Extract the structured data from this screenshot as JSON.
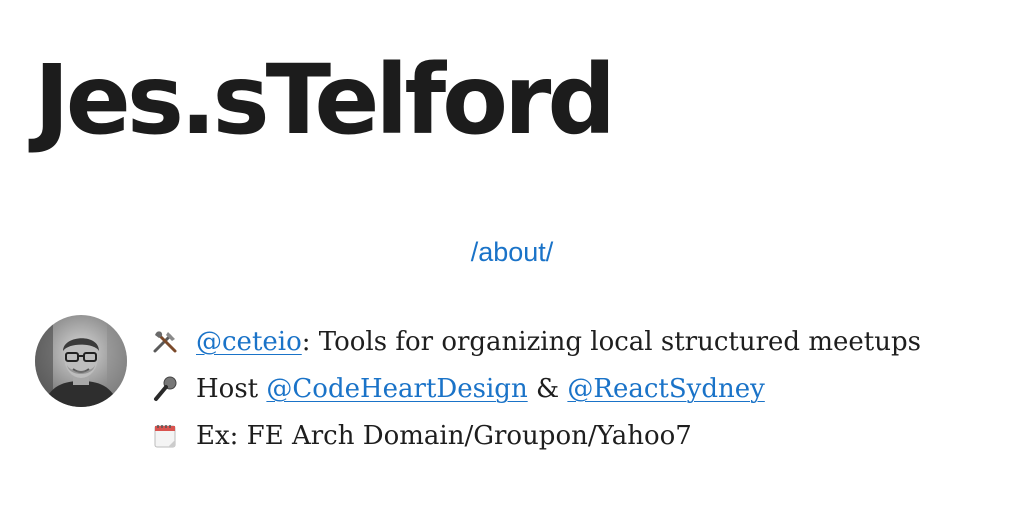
{
  "header": {
    "site_title": "Jes.sTelford"
  },
  "nav": {
    "about_label": "/about/"
  },
  "bio": {
    "line1": {
      "icon": "tools-icon",
      "handle": "@ceteio",
      "text": ": Tools for organizing local structured meetups"
    },
    "line2": {
      "icon": "microphone-icon",
      "prefix": "Host ",
      "handle1": "@CodeHeartDesign",
      "separator": " & ",
      "handle2": "@ReactSydney"
    },
    "line3": {
      "icon": "calendar-icon",
      "text": "Ex: FE Arch Domain/Groupon/Yahoo7"
    }
  },
  "colors": {
    "link": "#1a73c8",
    "title": "#1c1c1c",
    "text": "#1e1e1e"
  }
}
